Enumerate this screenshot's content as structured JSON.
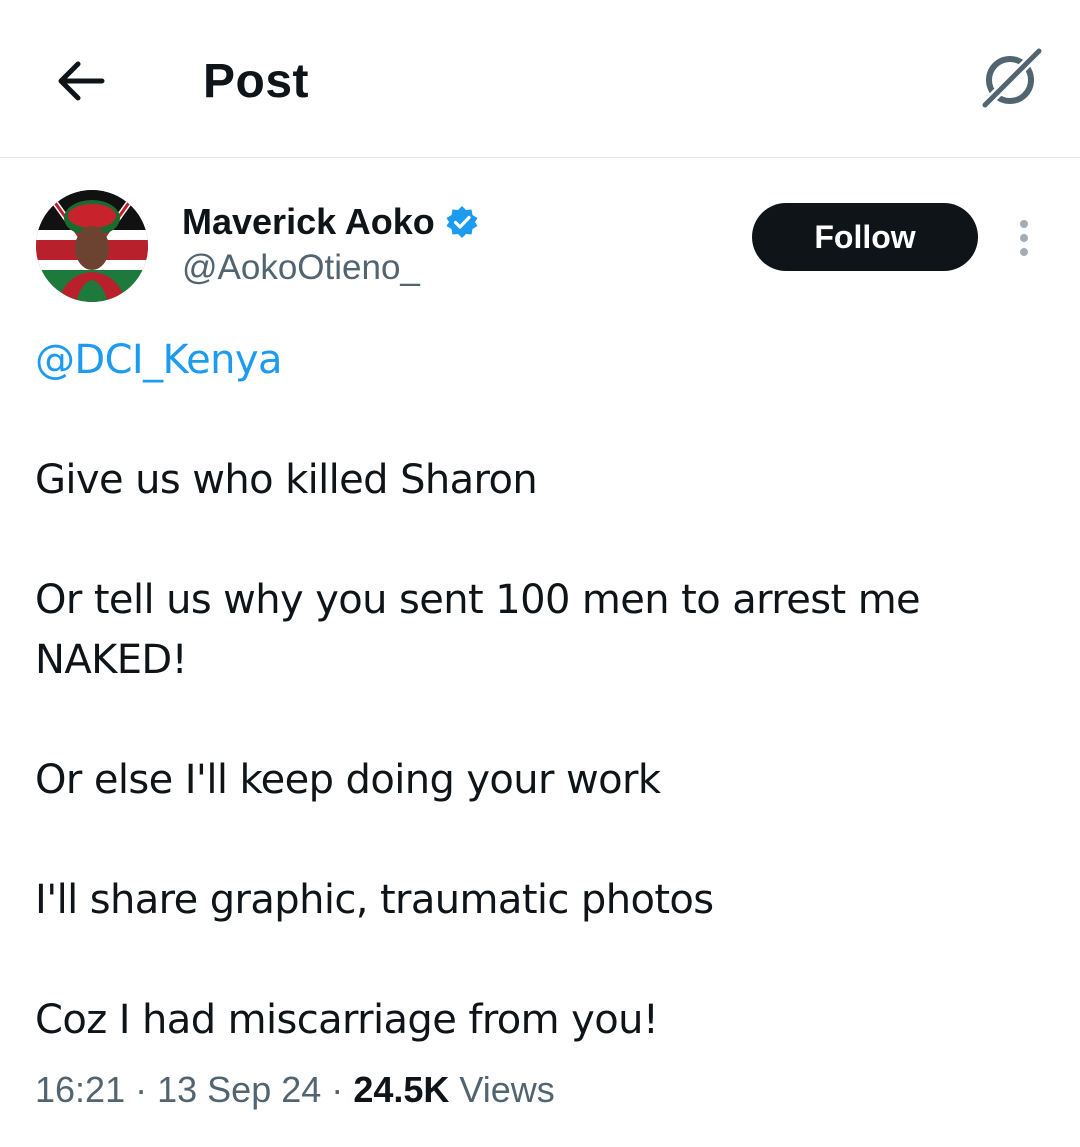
{
  "header": {
    "title": "Post",
    "back_icon": "arrow-left-icon",
    "grok_icon": "grok-icon"
  },
  "author": {
    "display_name": "Maverick Aoko",
    "handle": "@AokoOtieno_",
    "verified": true,
    "verified_color": "#1d9bf0"
  },
  "actions": {
    "follow_label": "Follow",
    "more_icon": "more-vertical-icon"
  },
  "post": {
    "mention": "@DCI_Kenya",
    "lines": [
      "Give us who killed Sharon",
      "Or tell us why you sent 100 men to arrest me NAKED!",
      "Or else I'll keep doing your work",
      "I'll share graphic, traumatic photos",
      "Coz I had miscarriage from you!"
    ]
  },
  "meta": {
    "time": "16:21",
    "date": "13 Sep 24",
    "separator": "·",
    "views_count": "24.5K",
    "views_label": "Views"
  },
  "colors": {
    "accent": "#1d9bf0",
    "text": "#0f1419",
    "secondary": "#536471"
  }
}
